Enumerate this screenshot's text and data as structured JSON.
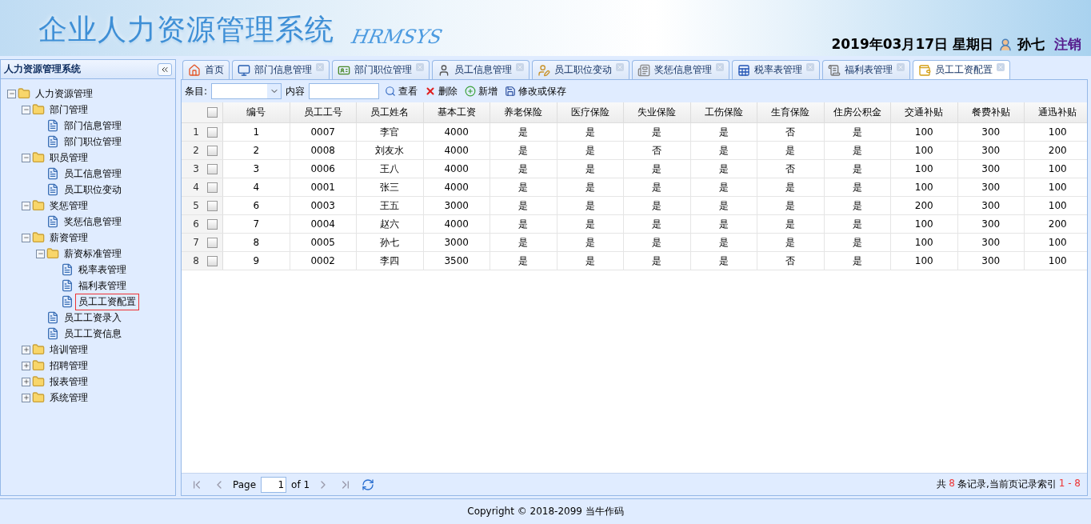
{
  "header": {
    "title": "企业人力资源管理系统",
    "subtitle": "HRMSYS",
    "date": "2019年03月17日 星期日",
    "user": "孙七",
    "logout": "注销"
  },
  "sidebar": {
    "title": "人力资源管理系统",
    "tree": [
      {
        "label": "人力资源管理",
        "kind": "folder",
        "expanded": true,
        "selected": false,
        "children": [
          {
            "label": "部门管理",
            "kind": "folder",
            "expanded": true,
            "selected": false,
            "children": [
              {
                "label": "部门信息管理",
                "kind": "page",
                "selected": false
              },
              {
                "label": "部门职位管理",
                "kind": "page",
                "selected": false
              }
            ]
          },
          {
            "label": "职员管理",
            "kind": "folder",
            "expanded": true,
            "selected": false,
            "children": [
              {
                "label": "员工信息管理",
                "kind": "page",
                "selected": false
              },
              {
                "label": "员工职位变动",
                "kind": "page",
                "selected": false
              }
            ]
          },
          {
            "label": "奖惩管理",
            "kind": "folder",
            "expanded": true,
            "selected": false,
            "children": [
              {
                "label": "奖惩信息管理",
                "kind": "page",
                "selected": false
              }
            ]
          },
          {
            "label": "薪资管理",
            "kind": "folder",
            "expanded": true,
            "selected": false,
            "children": [
              {
                "label": "薪资标准管理",
                "kind": "folder",
                "expanded": true,
                "selected": false,
                "children": [
                  {
                    "label": "税率表管理",
                    "kind": "page",
                    "selected": false
                  },
                  {
                    "label": "福利表管理",
                    "kind": "page",
                    "selected": false
                  },
                  {
                    "label": "员工工资配置",
                    "kind": "page",
                    "selected": true
                  }
                ]
              },
              {
                "label": "员工工资录入",
                "kind": "page",
                "selected": false
              },
              {
                "label": "员工工资信息",
                "kind": "page",
                "selected": false
              }
            ]
          },
          {
            "label": "培训管理",
            "kind": "folder",
            "expanded": false,
            "selected": false
          },
          {
            "label": "招聘管理",
            "kind": "folder",
            "expanded": false,
            "selected": false
          },
          {
            "label": "报表管理",
            "kind": "folder",
            "expanded": false,
            "selected": false
          },
          {
            "label": "系统管理",
            "kind": "folder",
            "expanded": false,
            "selected": false
          }
        ]
      }
    ]
  },
  "tabs": [
    {
      "label": "首页",
      "selected": false,
      "closable": false
    },
    {
      "label": "部门信息管理",
      "selected": false,
      "closable": true
    },
    {
      "label": "部门职位管理",
      "selected": false,
      "closable": true
    },
    {
      "label": "员工信息管理",
      "selected": false,
      "closable": true
    },
    {
      "label": "员工职位变动",
      "selected": false,
      "closable": true
    },
    {
      "label": "奖惩信息管理",
      "selected": false,
      "closable": true
    },
    {
      "label": "税率表管理",
      "selected": false,
      "closable": true
    },
    {
      "label": "福利表管理",
      "selected": false,
      "closable": true
    },
    {
      "label": "员工工资配置",
      "selected": true,
      "closable": true
    }
  ],
  "toolbar": {
    "field_label": "条目:",
    "content_label": "内容",
    "buttons": [
      "查看",
      "删除",
      "新增",
      "修改或保存"
    ]
  },
  "table": {
    "header_checked": false,
    "columns": [
      "编号",
      "员工工号",
      "员工姓名",
      "基本工资",
      "养老保险",
      "医疗保险",
      "失业保险",
      "工伤保险",
      "生育保险",
      "住房公积金",
      "交通补贴",
      "餐费补贴",
      "通迅补贴"
    ],
    "rows": [
      {
        "number": "1",
        "checked": false,
        "cells": [
          "1",
          "0007",
          "李官",
          "4000",
          "是",
          "是",
          "是",
          "是",
          "否",
          "是",
          "100",
          "300",
          "100"
        ]
      },
      {
        "number": "2",
        "checked": false,
        "cells": [
          "2",
          "0008",
          "刘友水",
          "4000",
          "是",
          "是",
          "否",
          "是",
          "是",
          "是",
          "100",
          "300",
          "200"
        ]
      },
      {
        "number": "3",
        "checked": false,
        "cells": [
          "3",
          "0006",
          "王八",
          "4000",
          "是",
          "是",
          "是",
          "是",
          "否",
          "是",
          "100",
          "300",
          "100"
        ]
      },
      {
        "number": "4",
        "checked": false,
        "cells": [
          "4",
          "0001",
          "张三",
          "4000",
          "是",
          "是",
          "是",
          "是",
          "是",
          "是",
          "100",
          "300",
          "100"
        ]
      },
      {
        "number": "5",
        "checked": false,
        "cells": [
          "6",
          "0003",
          "王五",
          "3000",
          "是",
          "是",
          "是",
          "是",
          "是",
          "是",
          "200",
          "300",
          "100"
        ]
      },
      {
        "number": "6",
        "checked": false,
        "cells": [
          "7",
          "0004",
          "赵六",
          "4000",
          "是",
          "是",
          "是",
          "是",
          "是",
          "是",
          "100",
          "300",
          "200"
        ]
      },
      {
        "number": "7",
        "checked": false,
        "cells": [
          "8",
          "0005",
          "孙七",
          "3000",
          "是",
          "是",
          "是",
          "是",
          "是",
          "是",
          "100",
          "300",
          "100"
        ]
      },
      {
        "number": "8",
        "checked": false,
        "cells": [
          "9",
          "0002",
          "李四",
          "3500",
          "是",
          "是",
          "是",
          "是",
          "否",
          "是",
          "100",
          "300",
          "100"
        ]
      }
    ]
  },
  "pager": {
    "page_label": "Page",
    "page": "1",
    "of": "of 1",
    "summary_prefix": "共",
    "total": "8",
    "summary_middle": "条记录,当前页记录索引",
    "range": "1 - 8"
  },
  "footer": "Copyright © 2018-2099 当牛作码"
}
